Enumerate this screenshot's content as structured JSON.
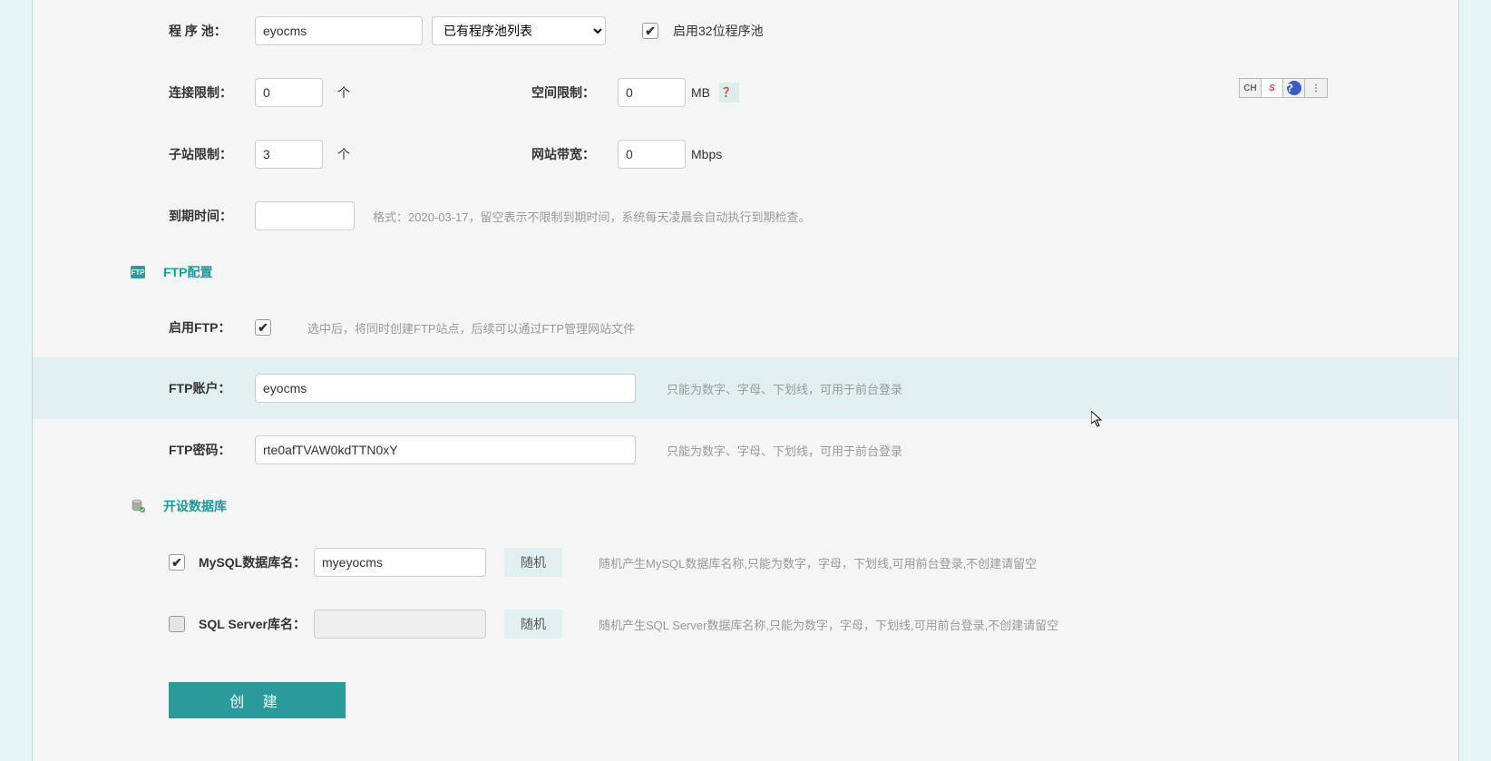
{
  "program_pool": {
    "label": "程 序 池：",
    "value": "eyocms",
    "dropdown_selected": "已有程序池列表",
    "enable32_label": "启用32位程序池"
  },
  "connection_limit": {
    "label": "连接限制：",
    "value": "0",
    "unit": "个"
  },
  "space_limit": {
    "label": "空间限制：",
    "value": "0",
    "unit": "MB",
    "help": "？"
  },
  "subsite_limit": {
    "label": "子站限制：",
    "value": "3",
    "unit": "个"
  },
  "bandwidth": {
    "label": "网站带宽：",
    "value": "0",
    "unit": "Mbps"
  },
  "expire": {
    "label": "到期时间：",
    "value": "",
    "hint": "格式：2020-03-17，留空表示不限制到期时间，系统每天凌晨会自动执行到期检查。"
  },
  "ftp_section": {
    "title": "FTP配置",
    "enable_label": "启用FTP：",
    "enable_hint": "选中后，将同时创建FTP站点，后续可以通过FTP管理网站文件",
    "account_label": "FTP账户：",
    "account_value": "eyocms",
    "account_hint": "只能为数字、字母、下划线，可用于前台登录",
    "password_label": "FTP密码：",
    "password_value": "rte0afTVAW0kdTTN0xY",
    "password_hint": "只能为数字、字母、下划线，可用于前台登录"
  },
  "db_section": {
    "title": "开设数据库",
    "mysql_label": "MySQL数据库名：",
    "mysql_value": "myeyocms",
    "mysql_hint": "随机产生MySQL数据库名称,只能为数字，字母，下划线,可用前台登录,不创建请留空",
    "sqlserver_label": "SQL Server库名：",
    "sqlserver_value": "",
    "sqlserver_hint": "随机产生SQL Server数据库名称,只能为数字，字母，下划线,可用前台登录,不创建请留空",
    "random_btn": "随机"
  },
  "create_btn": "创 建",
  "lang_toolbar": {
    "ch": "CH",
    "s": "S",
    "q": "?",
    "menu": "⋮"
  }
}
